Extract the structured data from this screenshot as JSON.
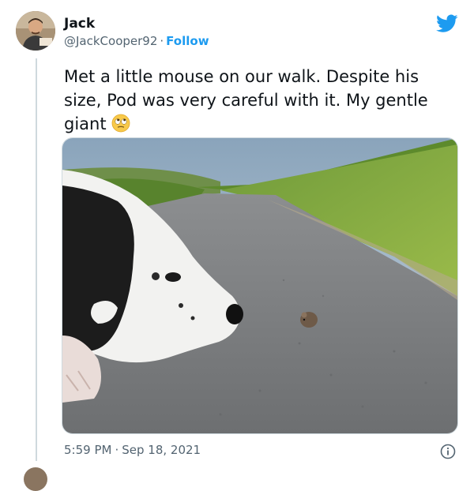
{
  "author": {
    "name": "Jack",
    "handle": "@JackCooper92",
    "separator": "·",
    "follow_label": "Follow"
  },
  "tweet": {
    "text": "Met a little mouse on our walk. Despite his size, Pod was very careful with it. My gentle giant",
    "emoji": "face-with-rolling-eyes",
    "time": "5:59 PM",
    "separator": "·",
    "date": "Sep 18, 2021"
  },
  "icons": {
    "brand": "twitter-bird-icon",
    "info": "info-icon"
  },
  "colors": {
    "accent": "#1d9bf0",
    "text": "#0f1419",
    "secondary_text": "#536471",
    "border": "#cfd9de"
  }
}
